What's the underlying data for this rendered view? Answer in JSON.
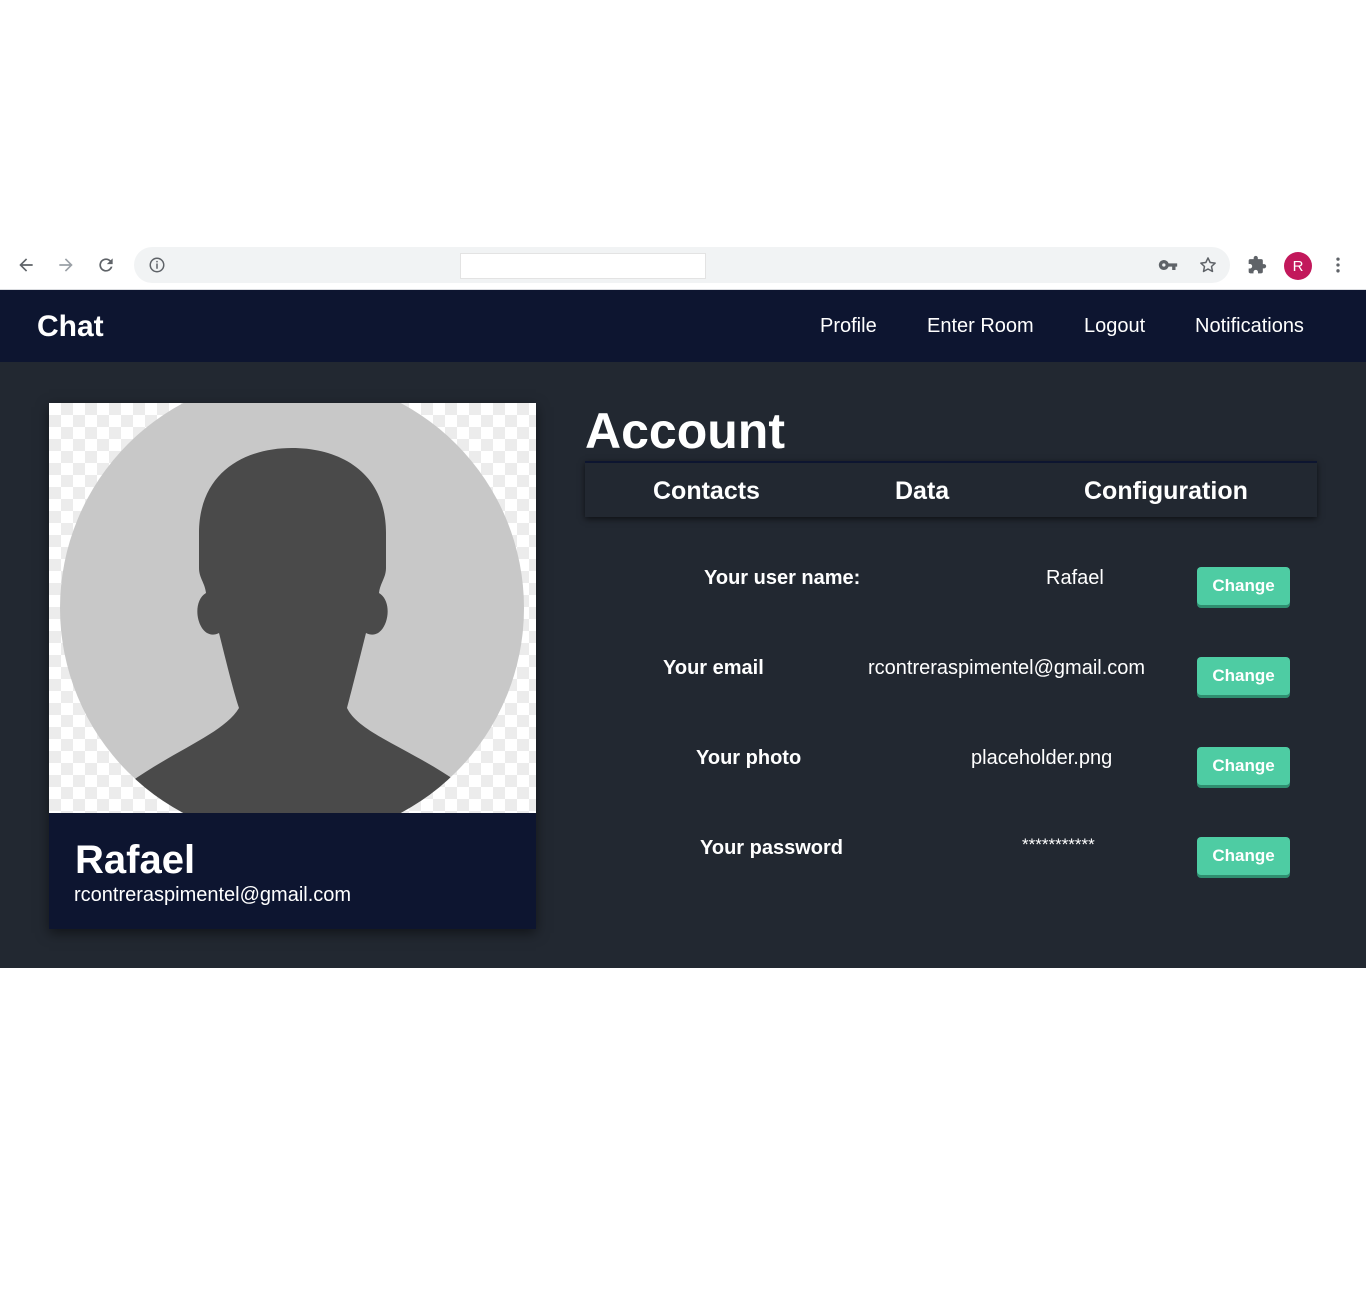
{
  "browser": {
    "icons": [
      "back-arrow-icon",
      "forward-arrow-icon",
      "reload-icon",
      "info-icon",
      "key-icon",
      "star-icon",
      "extensions-icon",
      "more-vert-icon"
    ],
    "profile_initial": "R",
    "profile_color": "#c2185b"
  },
  "nav": {
    "brand": "Chat",
    "links": [
      "Profile",
      "Enter Room",
      "Logout",
      "Notifications"
    ]
  },
  "profile_card": {
    "name": "Rafael",
    "email": "rcontreraspimentel@gmail.com"
  },
  "account": {
    "title": "Account",
    "tabs": [
      "Contacts",
      "Data",
      "Configuration"
    ],
    "rows": [
      {
        "label": "Your user name:",
        "value": "Rafael",
        "button": "Change"
      },
      {
        "label": "Your email",
        "value": "rcontreraspimentel@gmail.com",
        "button": "Change"
      },
      {
        "label": "Your photo",
        "value": "placeholder.png",
        "button": "Change"
      },
      {
        "label": "Your password",
        "value": "***********",
        "button": "Change"
      }
    ]
  },
  "colors": {
    "navbar": "#0d1530",
    "background": "#222831",
    "accent": "#4ecca3"
  }
}
